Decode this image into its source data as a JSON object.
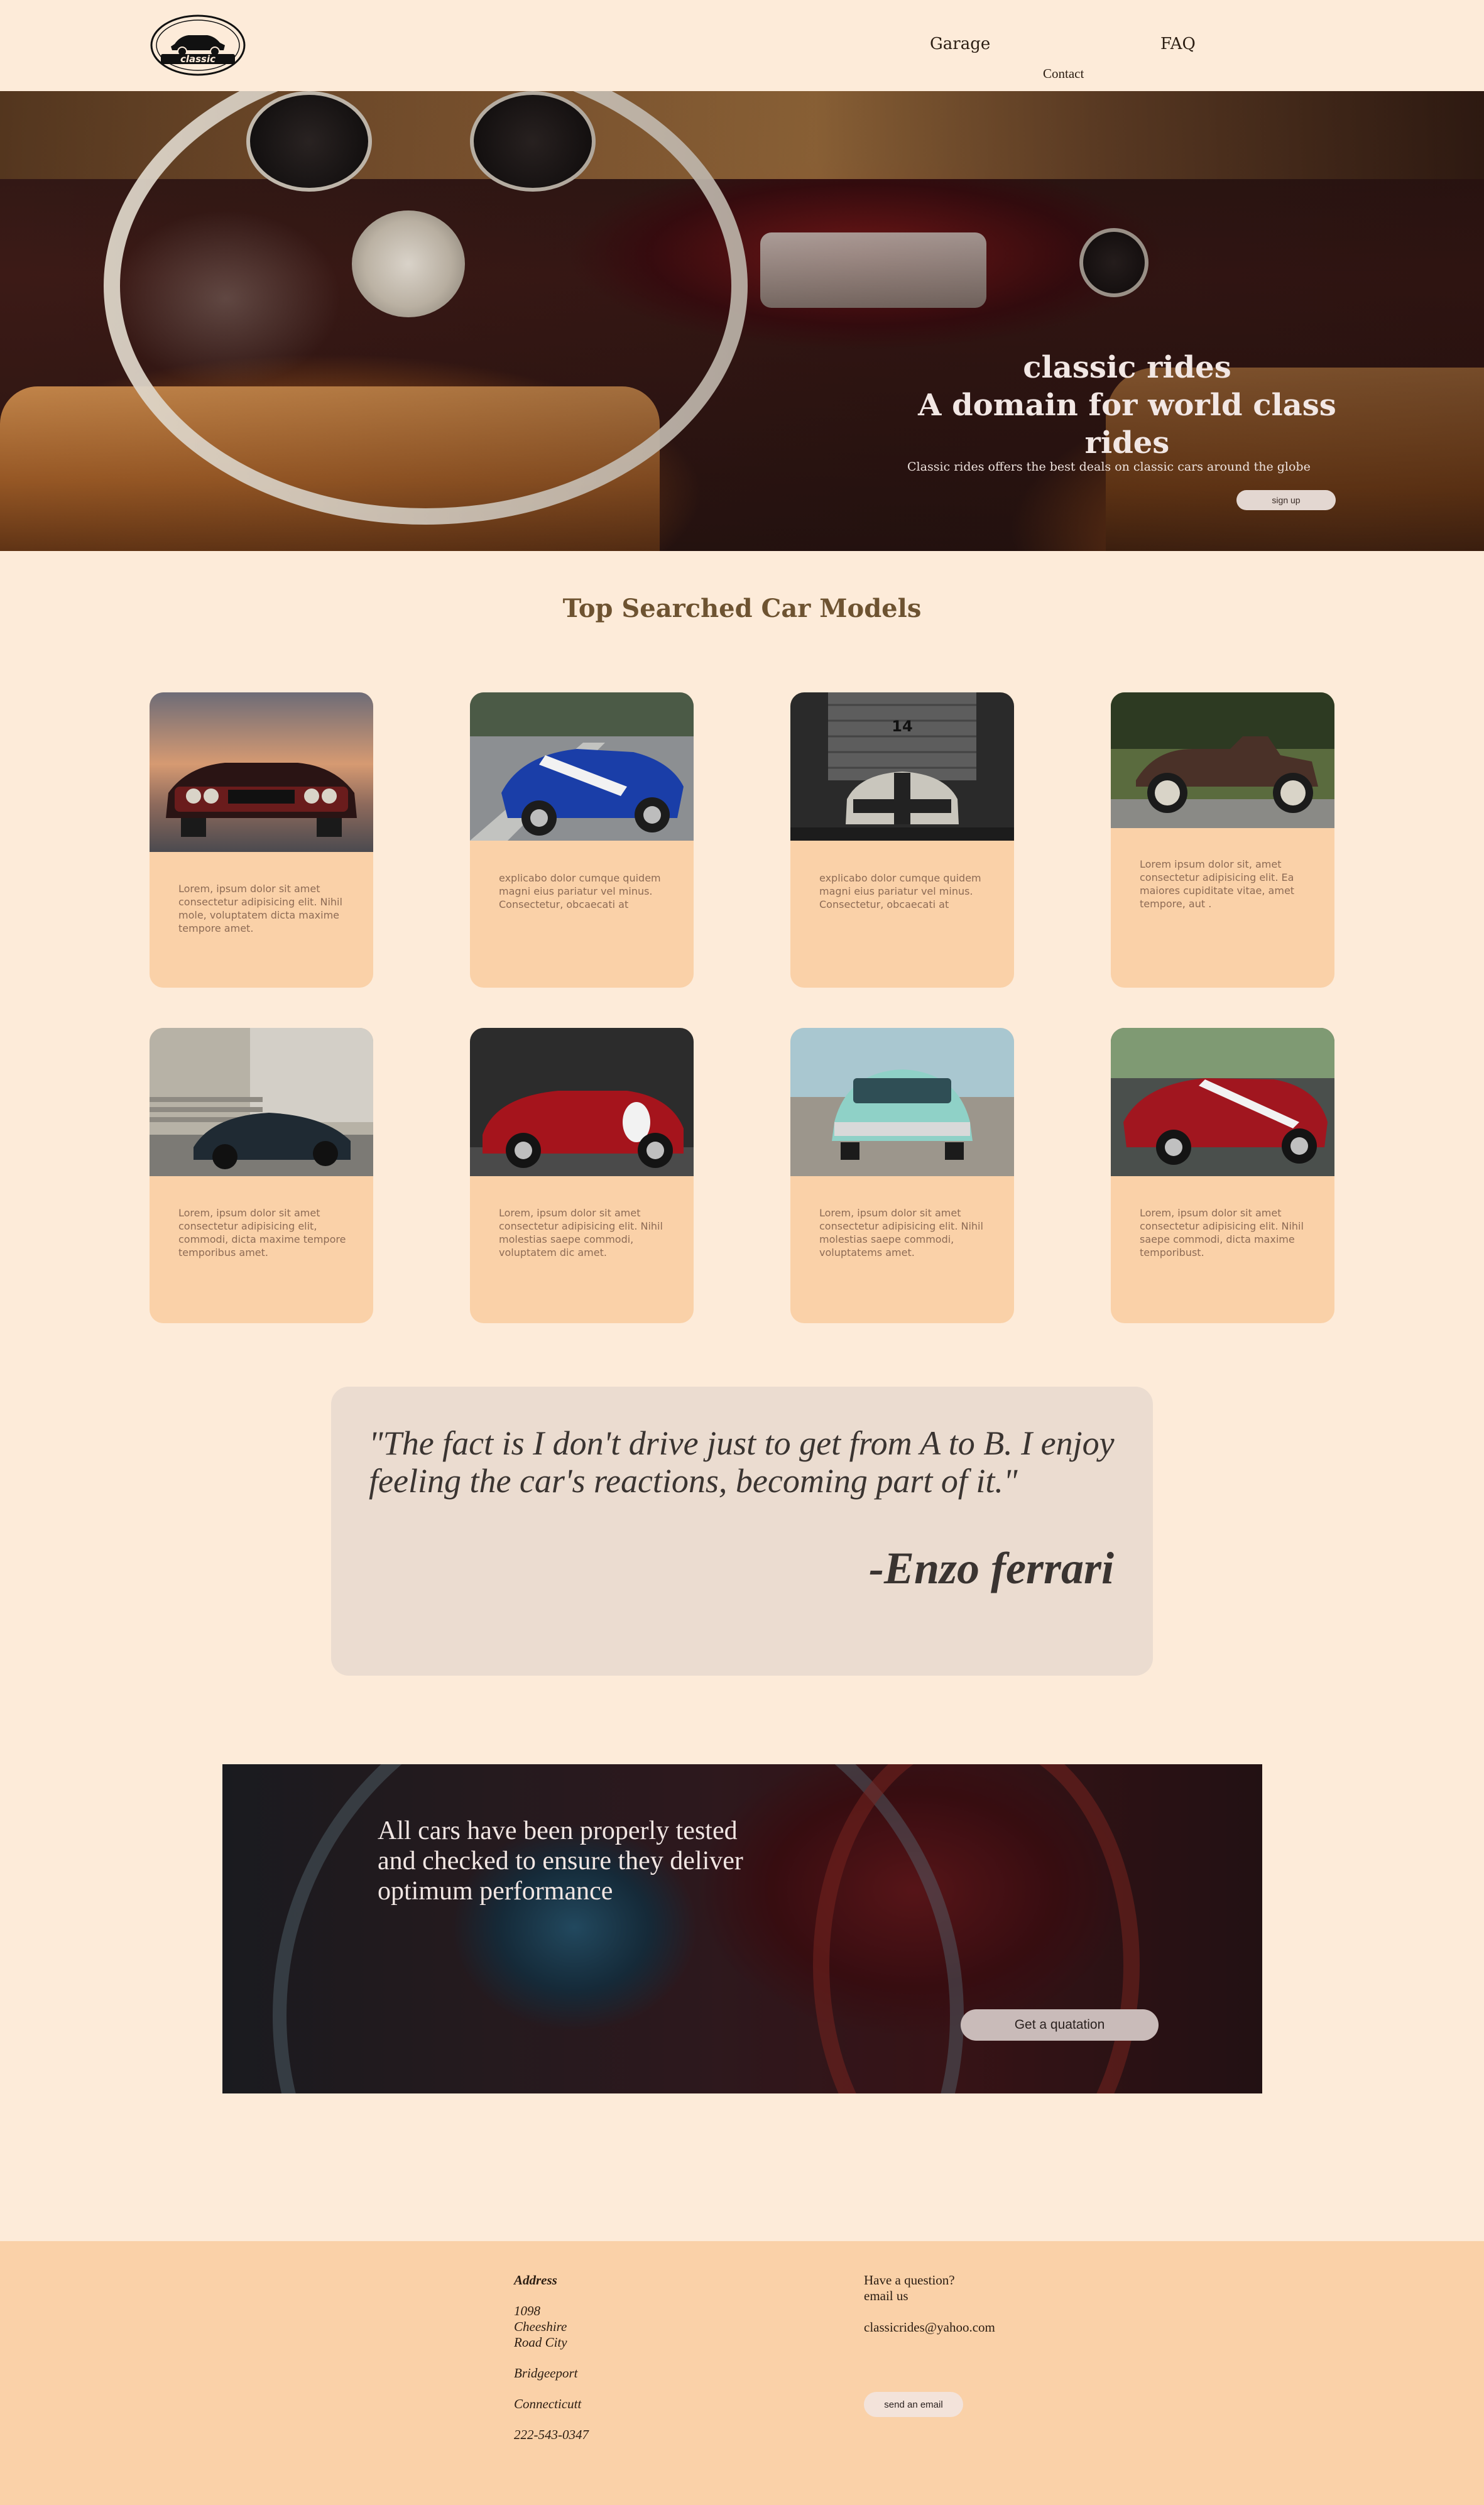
{
  "nav": {
    "logo_alt": "classic",
    "links": [
      {
        "label": "Garage"
      },
      {
        "label": "Contact"
      },
      {
        "label": "FAQ"
      }
    ]
  },
  "hero": {
    "title_line1": "classic rides",
    "title_line2": "A domain for world class rides",
    "subtitle": "Classic rides offers the best deals on classic cars around the globe",
    "button": "sign up"
  },
  "models": {
    "title": "Top Searched Car Models",
    "cards": [
      {
        "text": "Lorem, ipsum dolor sit amet consectetur adipisicing elit. Nihil mole, voluptatem dicta maxime tempore amet."
      },
      {
        "text": "explicabo dolor cumque quidem magni eius pariatur vel minus. Consectetur, obcaecati at"
      },
      {
        "text": "explicabo dolor cumque quidem magni eius pariatur vel minus. Consectetur, obcaecati at"
      },
      {
        "text": "Lorem ipsum dolor sit, amet consectetur adipisicing elit. Ea maiores cupiditate vitae, amet tempore, aut ."
      },
      {
        "text": "Lorem, ipsum dolor sit amet consectetur adipisicing elit, commodi, dicta maxime tempore temporibus amet."
      },
      {
        "text": "Lorem, ipsum dolor sit amet consectetur adipisicing elit. Nihil molestias saepe commodi, voluptatem dic amet."
      },
      {
        "text": "Lorem, ipsum dolor sit amet consectetur adipisicing elit. Nihil molestias saepe commodi, voluptatems amet."
      },
      {
        "text": "Lorem, ipsum dolor sit amet consectetur adipisicing elit. Nihil saepe commodi, dicta maxime temporibust."
      }
    ]
  },
  "quote": {
    "text": "\"The fact is I don't drive just to get from A to B. I enjoy feeling the car's reactions, becoming part of it.\"",
    "author": "-Enzo ferrari"
  },
  "promo": {
    "text": "All cars have been properly tested and checked to ensure they deliver optimum performance",
    "button": "Get a quatation"
  },
  "footer": {
    "address_heading": "Address",
    "address_lines": [
      "1098",
      "Cheeshire",
      "Road City"
    ],
    "city": "Bridgeeport",
    "state": "Connecticutt",
    "phone": "222-543-0347",
    "question_line1": "Have a question?",
    "question_line2": "email us",
    "email": "classicrides@yahoo.com",
    "button": "send an email"
  }
}
